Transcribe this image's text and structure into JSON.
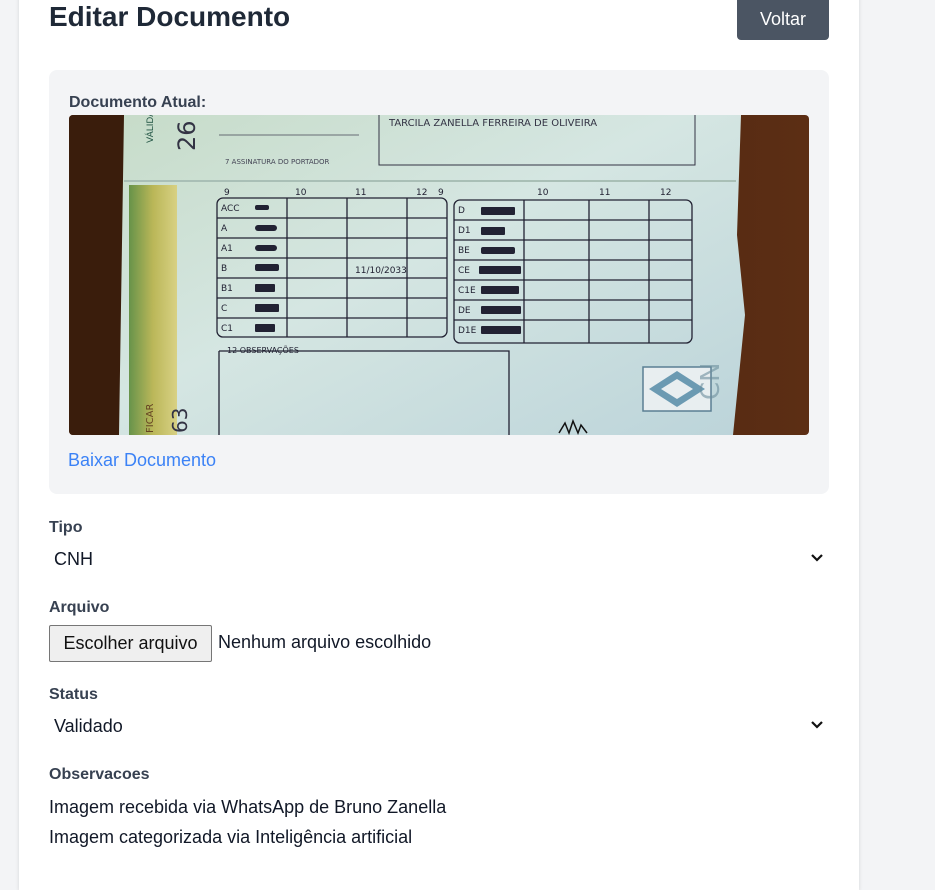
{
  "header": {
    "title": "Editar Documento",
    "back_label": "Voltar"
  },
  "document": {
    "label": "Documento Atual:",
    "download_label": "Baixar Documento",
    "image": {
      "holder_name": "TARCILA ZANELLA FERREIRA DE OLIVEIRA",
      "signature_label": "7 ASSINATURA DO PORTADOR",
      "observations_label": "12 OBSERVAÇÕES",
      "column_headers": [
        "9",
        "10",
        "11",
        "12"
      ],
      "left_categories": [
        "ACC",
        "A",
        "A1",
        "B",
        "B1",
        "C",
        "C1"
      ],
      "right_categories": [
        "D",
        "D1",
        "BE",
        "CE",
        "C1E",
        "DE",
        "D1E"
      ],
      "b_validity": "11/10/2033",
      "side_text_1": "VÁLIDA",
      "side_text_2": "26",
      "side_text_3": "FICAR",
      "side_text_4": "63",
      "stamp_text": "CN"
    }
  },
  "form": {
    "tipo": {
      "label": "Tipo",
      "value": "CNH"
    },
    "arquivo": {
      "label": "Arquivo",
      "button_label": "Escolher arquivo",
      "status": "Nenhum arquivo escolhido"
    },
    "status": {
      "label": "Status",
      "value": "Validado"
    },
    "observacoes": {
      "label": "Observacoes",
      "lines": [
        "Imagem recebida via WhatsApp de Bruno Zanella",
        "Imagem categorizada via Inteligência artificial"
      ]
    }
  },
  "colors": {
    "primary_button": "#4b5563",
    "link": "#3b82f6",
    "panel_bg": "#f3f4f6",
    "page_bg": "#f3f4f6"
  },
  "icons": {
    "select_chevron": "chevron-down-icon"
  }
}
